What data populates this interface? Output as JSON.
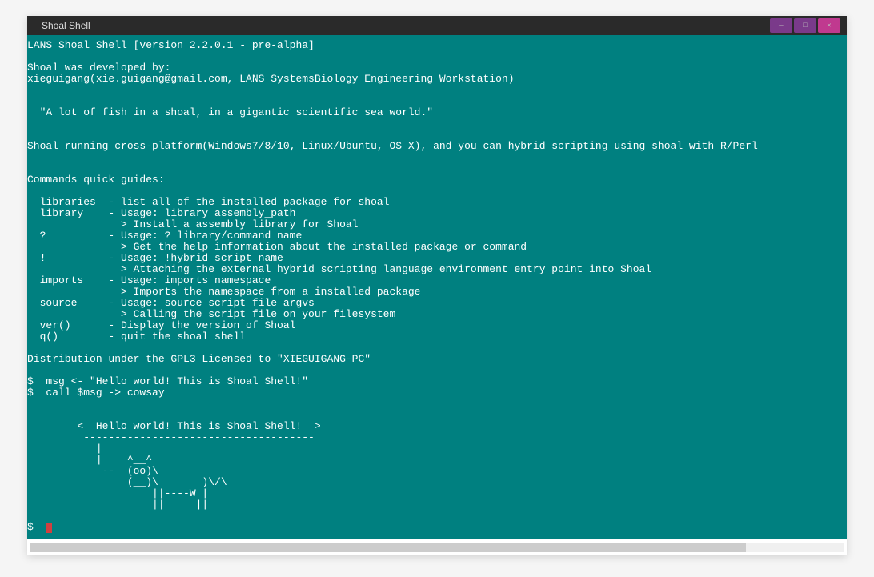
{
  "window": {
    "title": "Shoal Shell"
  },
  "terminal": {
    "banner_line": "LANS Shoal Shell [version 2.2.0.1 - pre-alpha]",
    "dev_line1": "Shoal was developed by:",
    "dev_line2": "xieguigang(xie.guigang@gmail.com, LANS SystemsBiology Engineering Workstation)",
    "quote": "  \"A lot of fish in a shoal, in a gigantic scientific sea world.\"",
    "platform_line": "Shoal running cross-platform(Windows7/8/10, Linux/Ubuntu, OS X), and you can hybrid scripting using shoal with R/Perl",
    "guides_header": "Commands quick guides:",
    "cmd_libraries": "  libraries  - list all of the installed package for shoal",
    "cmd_library1": "  library    - Usage: library assembly_path",
    "cmd_library2": "               > Install a assembly library for Shoal",
    "cmd_q1": "  ?          - Usage: ? library/command name",
    "cmd_q2": "               > Get the help information about the installed package or command",
    "cmd_bang1": "  !          - Usage: !hybrid_script_name",
    "cmd_bang2": "               > Attaching the external hybrid scripting language environment entry point into Shoal",
    "cmd_imports1": "  imports    - Usage: imports namespace",
    "cmd_imports2": "               > Imports the namespace from a installed package",
    "cmd_source1": "  source     - Usage: source script_file argvs",
    "cmd_source2": "               > Calling the script file on your filesystem",
    "cmd_ver": "  ver()      - Display the version of Shoal",
    "cmd_quit": "  q()        - quit the shoal shell",
    "dist_line": "Distribution under the GPL3 Licensed to \"XIEGUIGANG-PC\"",
    "prompt1": "$  msg <- \"Hello world! This is Shoal Shell!\"",
    "prompt2": "$  call $msg -> cowsay",
    "cow1": "         _____________________________________",
    "cow2": "        <  Hello world! This is Shoal Shell!  >",
    "cow3": "         -------------------------------------",
    "cow4": "           |",
    "cow5": "           |    ^__^",
    "cow6": "            --  (oo)\\_______",
    "cow7": "                (__)\\       )\\/\\",
    "cow8": "                    ||----W |",
    "cow9": "                    ||     ||",
    "prompt3": "$  "
  }
}
